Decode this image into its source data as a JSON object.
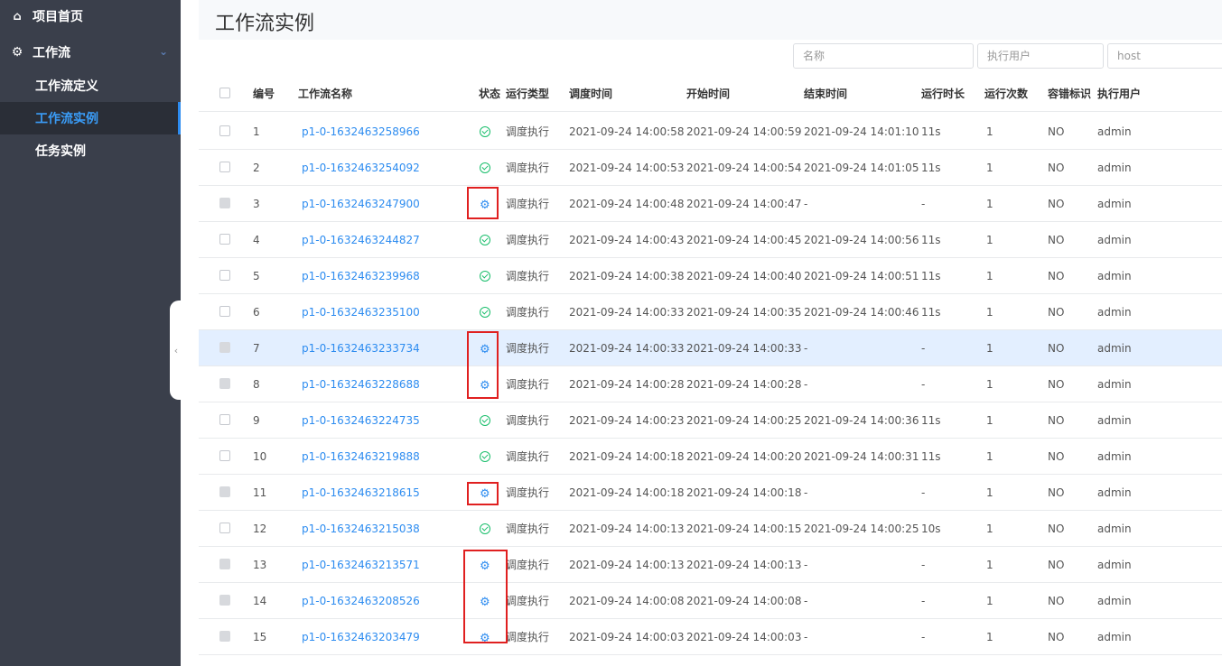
{
  "sidebar": {
    "home_label": "项目首页",
    "group_label": "工作流",
    "items": [
      {
        "label": "工作流定义"
      },
      {
        "label": "工作流实例"
      },
      {
        "label": "任务实例"
      }
    ]
  },
  "page": {
    "title": "工作流实例"
  },
  "search": {
    "name_placeholder": "名称",
    "user_placeholder": "执行用户",
    "host_placeholder": "host"
  },
  "table": {
    "headers": [
      "编号",
      "工作流名称",
      "状态",
      "运行类型",
      "调度时间",
      "开始时间",
      "结束时间",
      "运行时长",
      "运行次数",
      "容错标识",
      "执行用户"
    ],
    "rows": [
      {
        "id": "1",
        "name": "p1-0-1632463258966",
        "state": "success",
        "type": "调度执行",
        "schedule": "2021-09-24 14:00:58",
        "start": "2021-09-24 14:00:59",
        "end": "2021-09-24 14:01:10",
        "duration": "11s",
        "runs": "1",
        "failover": "NO",
        "user": "admin"
      },
      {
        "id": "2",
        "name": "p1-0-1632463254092",
        "state": "success",
        "type": "调度执行",
        "schedule": "2021-09-24 14:00:53",
        "start": "2021-09-24 14:00:54",
        "end": "2021-09-24 14:01:05",
        "duration": "11s",
        "runs": "1",
        "failover": "NO",
        "user": "admin"
      },
      {
        "id": "3",
        "name": "p1-0-1632463247900",
        "state": "running",
        "type": "调度执行",
        "schedule": "2021-09-24 14:00:48",
        "start": "2021-09-24 14:00:47",
        "end": "-",
        "duration": "-",
        "runs": "1",
        "failover": "NO",
        "user": "admin"
      },
      {
        "id": "4",
        "name": "p1-0-1632463244827",
        "state": "success",
        "type": "调度执行",
        "schedule": "2021-09-24 14:00:43",
        "start": "2021-09-24 14:00:45",
        "end": "2021-09-24 14:00:56",
        "duration": "11s",
        "runs": "1",
        "failover": "NO",
        "user": "admin"
      },
      {
        "id": "5",
        "name": "p1-0-1632463239968",
        "state": "success",
        "type": "调度执行",
        "schedule": "2021-09-24 14:00:38",
        "start": "2021-09-24 14:00:40",
        "end": "2021-09-24 14:00:51",
        "duration": "11s",
        "runs": "1",
        "failover": "NO",
        "user": "admin"
      },
      {
        "id": "6",
        "name": "p1-0-1632463235100",
        "state": "success",
        "type": "调度执行",
        "schedule": "2021-09-24 14:00:33",
        "start": "2021-09-24 14:00:35",
        "end": "2021-09-24 14:00:46",
        "duration": "11s",
        "runs": "1",
        "failover": "NO",
        "user": "admin"
      },
      {
        "id": "7",
        "name": "p1-0-1632463233734",
        "state": "running",
        "type": "调度执行",
        "schedule": "2021-09-24 14:00:33",
        "start": "2021-09-24 14:00:33",
        "end": "-",
        "duration": "-",
        "runs": "1",
        "failover": "NO",
        "user": "admin"
      },
      {
        "id": "8",
        "name": "p1-0-1632463228688",
        "state": "running",
        "type": "调度执行",
        "schedule": "2021-09-24 14:00:28",
        "start": "2021-09-24 14:00:28",
        "end": "-",
        "duration": "-",
        "runs": "1",
        "failover": "NO",
        "user": "admin"
      },
      {
        "id": "9",
        "name": "p1-0-1632463224735",
        "state": "success",
        "type": "调度执行",
        "schedule": "2021-09-24 14:00:23",
        "start": "2021-09-24 14:00:25",
        "end": "2021-09-24 14:00:36",
        "duration": "11s",
        "runs": "1",
        "failover": "NO",
        "user": "admin"
      },
      {
        "id": "10",
        "name": "p1-0-1632463219888",
        "state": "success",
        "type": "调度执行",
        "schedule": "2021-09-24 14:00:18",
        "start": "2021-09-24 14:00:20",
        "end": "2021-09-24 14:00:31",
        "duration": "11s",
        "runs": "1",
        "failover": "NO",
        "user": "admin"
      },
      {
        "id": "11",
        "name": "p1-0-1632463218615",
        "state": "running",
        "type": "调度执行",
        "schedule": "2021-09-24 14:00:18",
        "start": "2021-09-24 14:00:18",
        "end": "-",
        "duration": "-",
        "runs": "1",
        "failover": "NO",
        "user": "admin"
      },
      {
        "id": "12",
        "name": "p1-0-1632463215038",
        "state": "success",
        "type": "调度执行",
        "schedule": "2021-09-24 14:00:13",
        "start": "2021-09-24 14:00:15",
        "end": "2021-09-24 14:00:25",
        "duration": "10s",
        "runs": "1",
        "failover": "NO",
        "user": "admin"
      },
      {
        "id": "13",
        "name": "p1-0-1632463213571",
        "state": "running",
        "type": "调度执行",
        "schedule": "2021-09-24 14:00:13",
        "start": "2021-09-24 14:00:13",
        "end": "-",
        "duration": "-",
        "runs": "1",
        "failover": "NO",
        "user": "admin"
      },
      {
        "id": "14",
        "name": "p1-0-1632463208526",
        "state": "running",
        "type": "调度执行",
        "schedule": "2021-09-24 14:00:08",
        "start": "2021-09-24 14:00:08",
        "end": "-",
        "duration": "-",
        "runs": "1",
        "failover": "NO",
        "user": "admin"
      },
      {
        "id": "15",
        "name": "p1-0-1632463203479",
        "state": "running",
        "type": "调度执行",
        "schedule": "2021-09-24 14:00:03",
        "start": "2021-09-24 14:00:03",
        "end": "-",
        "duration": "-",
        "runs": "1",
        "failover": "NO",
        "user": "admin"
      }
    ]
  },
  "colors": {
    "accent": "#2d8cf0",
    "success": "#19be6b",
    "highlight_box": "#e02020",
    "sidebar_bg": "#3a3f4b"
  }
}
